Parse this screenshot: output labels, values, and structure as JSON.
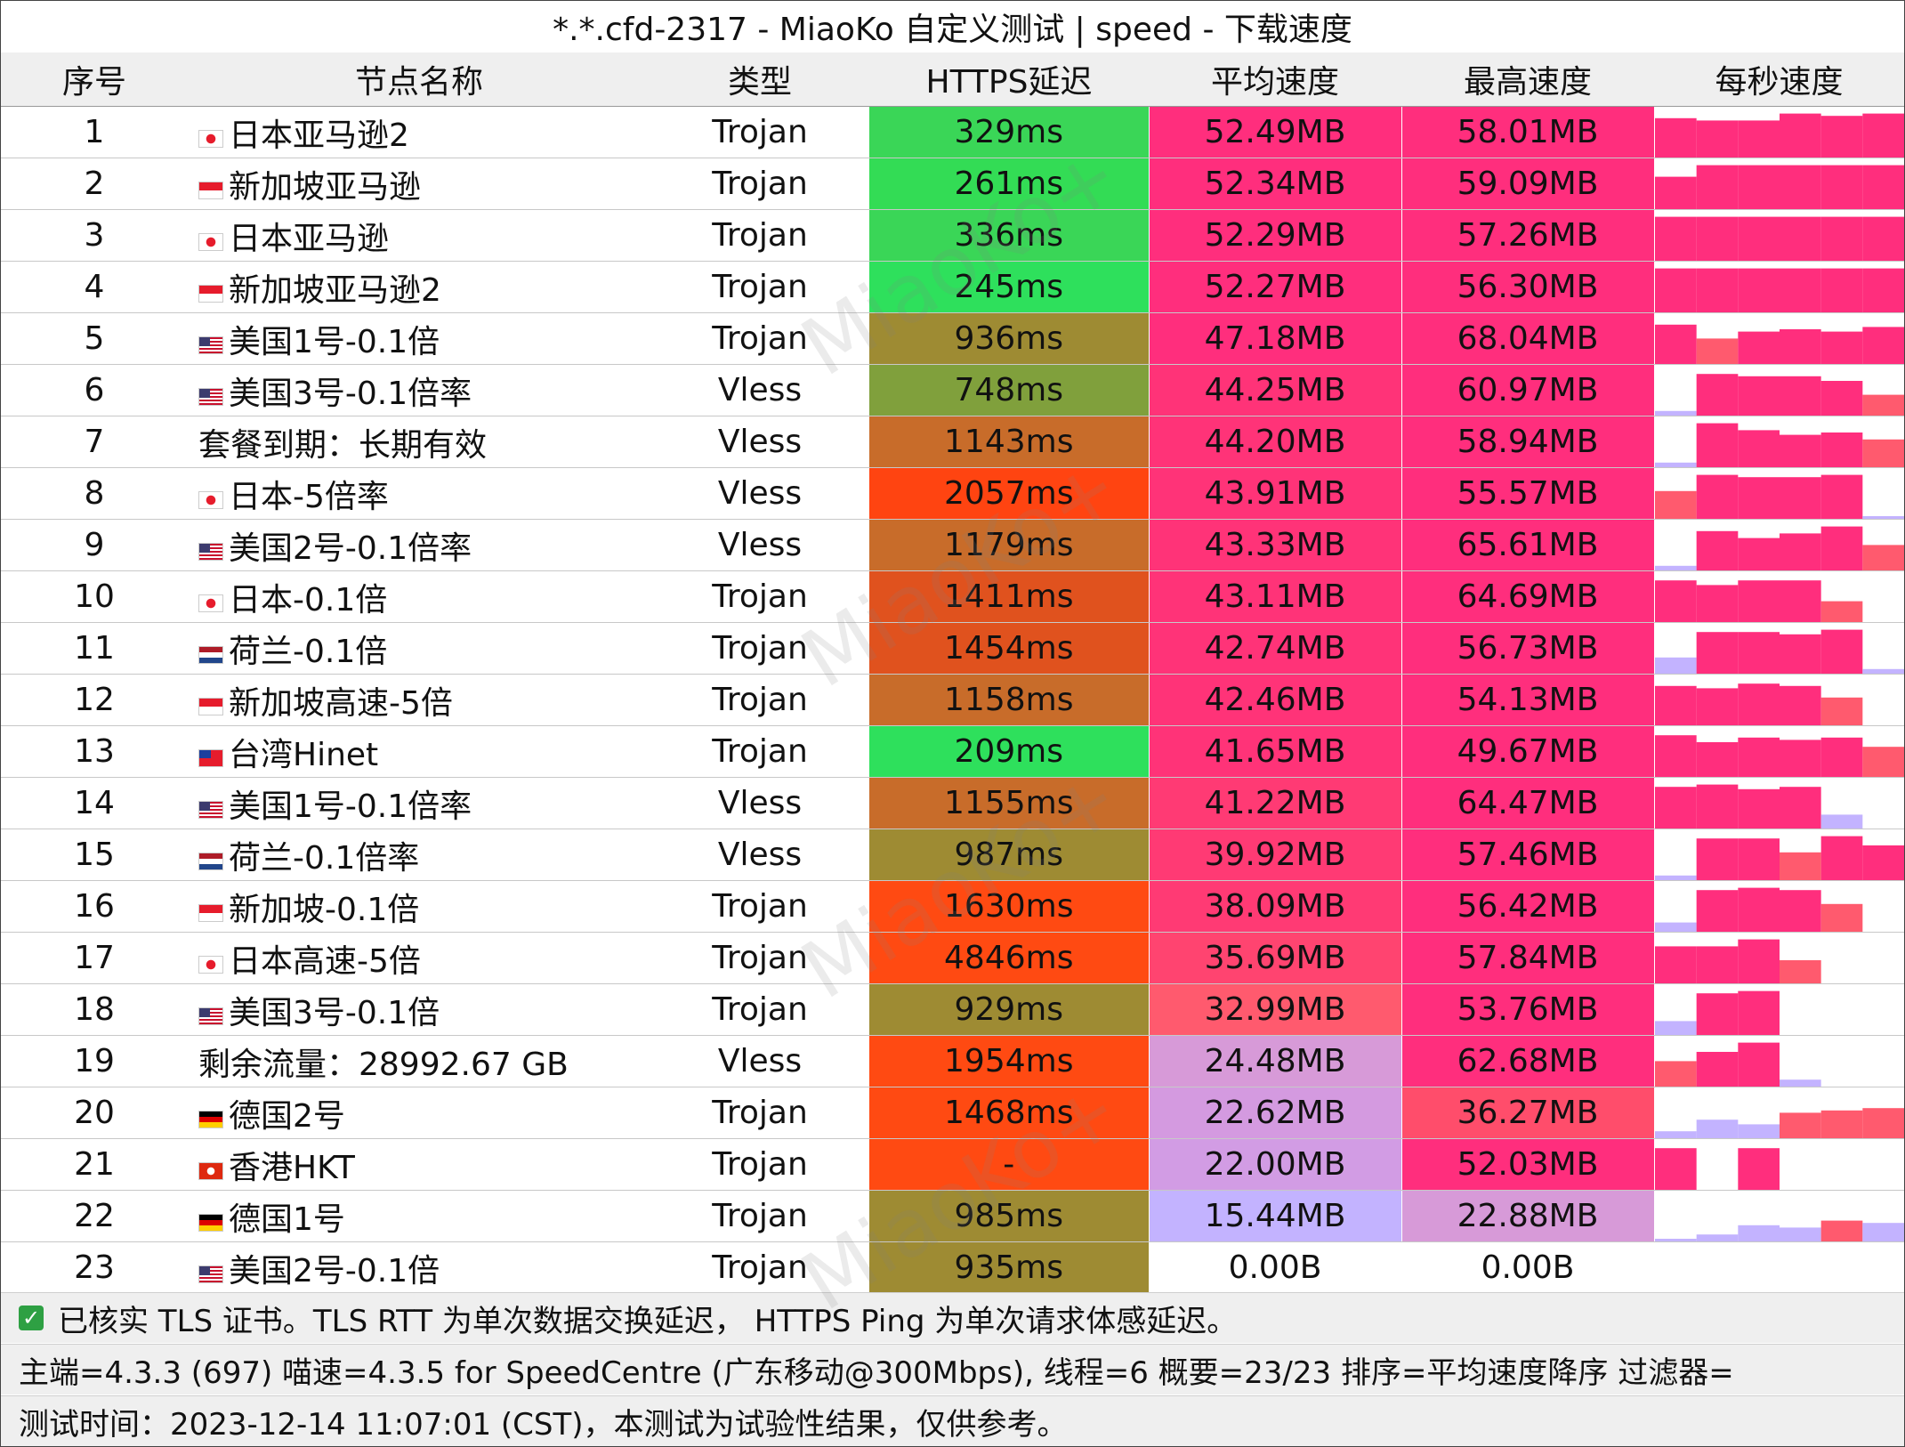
{
  "title": "*.*.cfd-2317 - MiaoKo 自定义测试 | speed - 下载速度",
  "watermark": "MiaoKo+",
  "columns": [
    "序号",
    "节点名称",
    "类型",
    "HTTPS延迟",
    "平均速度",
    "最高速度",
    "每秒速度"
  ],
  "rows": [
    {
      "idx": "1",
      "flag": "jp",
      "name": "日本亚马逊2",
      "type": "Trojan",
      "latency": "329ms",
      "latency_color": "#3ad657",
      "avg": "52.49MB",
      "avg_color": "#ff2e7d",
      "max": "58.01MB",
      "max_color": "#ff2e7d",
      "spark": [
        0.85,
        0.8,
        0.8,
        0.95,
        0.9,
        0.95
      ]
    },
    {
      "idx": "2",
      "flag": "sg",
      "name": "新加坡亚马逊",
      "type": "Trojan",
      "latency": "261ms",
      "latency_color": "#33dc55",
      "avg": "52.34MB",
      "avg_color": "#ff2e7d",
      "max": "59.09MB",
      "max_color": "#ff2e7d",
      "spark": [
        0.7,
        0.95,
        0.95,
        0.95,
        0.95,
        0.95
      ]
    },
    {
      "idx": "3",
      "flag": "jp",
      "name": "日本亚马逊",
      "type": "Trojan",
      "latency": "336ms",
      "latency_color": "#3ad657",
      "avg": "52.29MB",
      "avg_color": "#ff2e7d",
      "max": "57.26MB",
      "max_color": "#ff2e7d",
      "spark": [
        0.95,
        0.95,
        0.95,
        0.95,
        0.95,
        0.95
      ]
    },
    {
      "idx": "4",
      "flag": "sg",
      "name": "新加坡亚马逊2",
      "type": "Trojan",
      "latency": "245ms",
      "latency_color": "#2ee05c",
      "avg": "52.27MB",
      "avg_color": "#ff2e7d",
      "max": "56.30MB",
      "max_color": "#ff2e7d",
      "spark": [
        0.95,
        0.95,
        0.95,
        0.95,
        0.95,
        0.95
      ]
    },
    {
      "idx": "5",
      "flag": "us",
      "name": "美国1号-0.1倍",
      "type": "Trojan",
      "latency": "936ms",
      "latency_color": "#9e8b33",
      "avg": "47.18MB",
      "avg_color": "#ff2e7d",
      "max": "68.04MB",
      "max_color": "#ff2e7d",
      "spark": [
        0.85,
        0.55,
        0.7,
        0.75,
        0.7,
        0.8
      ]
    },
    {
      "idx": "6",
      "flag": "us",
      "name": "美国3号-0.1倍率",
      "type": "Vless",
      "latency": "748ms",
      "latency_color": "#80a03c",
      "avg": "44.25MB",
      "avg_color": "#ff3378",
      "max": "60.97MB",
      "max_color": "#ff2e7d",
      "spark": [
        0.1,
        0.9,
        0.85,
        0.85,
        0.75,
        0.45
      ]
    },
    {
      "idx": "7",
      "flag": "",
      "name": "套餐到期：长期有效",
      "type": "Vless",
      "latency": "1143ms",
      "latency_color": "#c86c2a",
      "avg": "44.20MB",
      "avg_color": "#ff3378",
      "max": "58.94MB",
      "max_color": "#ff2e7d",
      "spark": [
        0.1,
        0.95,
        0.8,
        0.7,
        0.75,
        0.6
      ]
    },
    {
      "idx": "8",
      "flag": "jp",
      "name": "日本-5倍率",
      "type": "Vless",
      "latency": "2057ms",
      "latency_color": "#ff4411",
      "avg": "43.91MB",
      "avg_color": "#ff3378",
      "max": "55.57MB",
      "max_color": "#ff2e7d",
      "spark": [
        0.6,
        0.95,
        0.9,
        0.9,
        0.95,
        0.05
      ]
    },
    {
      "idx": "9",
      "flag": "us",
      "name": "美国2号-0.1倍率",
      "type": "Vless",
      "latency": "1179ms",
      "latency_color": "#c86c2a",
      "avg": "43.33MB",
      "avg_color": "#ff3378",
      "max": "65.61MB",
      "max_color": "#ff2e7d",
      "spark": [
        0.1,
        0.85,
        0.7,
        0.8,
        0.95,
        0.55
      ]
    },
    {
      "idx": "10",
      "flag": "jp",
      "name": "日本-0.1倍",
      "type": "Trojan",
      "latency": "1411ms",
      "latency_color": "#e0521e",
      "avg": "43.11MB",
      "avg_color": "#ff3378",
      "max": "64.69MB",
      "max_color": "#ff2e7d",
      "spark": [
        0.9,
        0.8,
        0.9,
        0.9,
        0.45,
        0.0
      ]
    },
    {
      "idx": "11",
      "flag": "nl",
      "name": "荷兰-0.1倍",
      "type": "Trojan",
      "latency": "1454ms",
      "latency_color": "#e0521e",
      "avg": "42.74MB",
      "avg_color": "#ff3378",
      "max": "56.73MB",
      "max_color": "#ff2e7d",
      "spark": [
        0.35,
        0.9,
        0.9,
        0.85,
        0.95,
        0.1
      ]
    },
    {
      "idx": "12",
      "flag": "sg",
      "name": "新加坡高速-5倍",
      "type": "Trojan",
      "latency": "1158ms",
      "latency_color": "#c86c2a",
      "avg": "42.46MB",
      "avg_color": "#ff3378",
      "max": "54.13MB",
      "max_color": "#ff2e7d",
      "spark": [
        0.85,
        0.8,
        0.9,
        0.85,
        0.6,
        0.0
      ]
    },
    {
      "idx": "13",
      "flag": "tw",
      "name": "台湾Hinet",
      "type": "Trojan",
      "latency": "209ms",
      "latency_color": "#2ee05c",
      "avg": "41.65MB",
      "avg_color": "#ff3378",
      "max": "49.67MB",
      "max_color": "#ff2e7d",
      "spark": [
        0.9,
        0.75,
        0.85,
        0.8,
        0.85,
        0.65
      ]
    },
    {
      "idx": "14",
      "flag": "us",
      "name": "美国1号-0.1倍率",
      "type": "Vless",
      "latency": "1155ms",
      "latency_color": "#c86c2a",
      "avg": "41.22MB",
      "avg_color": "#ff3a74",
      "max": "64.47MB",
      "max_color": "#ff2e7d",
      "spark": [
        0.9,
        0.95,
        0.85,
        0.9,
        0.3,
        0.0
      ]
    },
    {
      "idx": "15",
      "flag": "nl",
      "name": "荷兰-0.1倍率",
      "type": "Vless",
      "latency": "987ms",
      "latency_color": "#9e8b33",
      "avg": "39.92MB",
      "avg_color": "#ff3a74",
      "max": "57.46MB",
      "max_color": "#ff2e7d",
      "spark": [
        0.1,
        0.9,
        0.9,
        0.6,
        0.95,
        0.75
      ]
    },
    {
      "idx": "16",
      "flag": "sg",
      "name": "新加坡-0.1倍",
      "type": "Trojan",
      "latency": "1630ms",
      "latency_color": "#ff4a12",
      "avg": "38.09MB",
      "avg_color": "#ff3a74",
      "max": "56.42MB",
      "max_color": "#ff2e7d",
      "spark": [
        0.2,
        0.9,
        0.95,
        0.9,
        0.6,
        0.0
      ]
    },
    {
      "idx": "17",
      "flag": "jp",
      "name": "日本高速-5倍",
      "type": "Trojan",
      "latency": "4846ms",
      "latency_color": "#ff4a12",
      "avg": "35.69MB",
      "avg_color": "#ff4470",
      "max": "57.84MB",
      "max_color": "#ff2e7d",
      "spark": [
        0.8,
        0.8,
        0.95,
        0.5,
        0.0,
        0.0
      ]
    },
    {
      "idx": "18",
      "flag": "us",
      "name": "美国3号-0.1倍",
      "type": "Trojan",
      "latency": "929ms",
      "latency_color": "#9e8b33",
      "avg": "32.99MB",
      "avg_color": "#ff5a6e",
      "max": "53.76MB",
      "max_color": "#ff2e7d",
      "spark": [
        0.3,
        0.9,
        0.95,
        0.0,
        0.0,
        0.0
      ]
    },
    {
      "idx": "19",
      "flag": "",
      "name": "剩余流量：28992.67 GB",
      "type": "Vless",
      "latency": "1954ms",
      "latency_color": "#ff4a12",
      "avg": "24.48MB",
      "avg_color": "#d79ad8",
      "max": "62.68MB",
      "max_color": "#ff2e7d",
      "spark": [
        0.55,
        0.75,
        0.95,
        0.15,
        0.0,
        0.0
      ]
    },
    {
      "idx": "20",
      "flag": "de",
      "name": "德国2号",
      "type": "Trojan",
      "latency": "1468ms",
      "latency_color": "#ff4a12",
      "avg": "22.62MB",
      "avg_color": "#d49ae0",
      "max": "36.27MB",
      "max_color": "#ff4d6b",
      "spark": [
        0.15,
        0.4,
        0.3,
        0.55,
        0.6,
        0.65
      ]
    },
    {
      "idx": "21",
      "flag": "hk",
      "name": "香港HKT",
      "type": "Trojan",
      "latency": "-",
      "latency_color": "#ff4a12",
      "avg": "22.00MB",
      "avg_color": "#d29ce4",
      "max": "52.03MB",
      "max_color": "#ff2e7d",
      "spark": [
        0.9,
        0.0,
        0.9,
        0.0,
        0.0,
        0.0
      ]
    },
    {
      "idx": "22",
      "flag": "de",
      "name": "德国1号",
      "type": "Trojan",
      "latency": "985ms",
      "latency_color": "#9e8b33",
      "avg": "15.44MB",
      "avg_color": "#c3b3ff",
      "max": "22.88MB",
      "max_color": "#d79ad8",
      "spark": [
        0.05,
        0.15,
        0.35,
        0.3,
        0.45,
        0.4
      ]
    },
    {
      "idx": "23",
      "flag": "us",
      "name": "美国2号-0.1倍",
      "type": "Trojan",
      "latency": "935ms",
      "latency_color": "#9e8b33",
      "avg": "0.00B",
      "avg_color": "#ffffff",
      "max": "0.00B",
      "max_color": "#ffffff",
      "spark": [
        0,
        0,
        0,
        0,
        0,
        0
      ]
    }
  ],
  "footer": {
    "line1": "已核实 TLS 证书。TLS RTT 为单次数据交换延迟， HTTPS Ping 为单次请求体感延迟。",
    "line2": "主端=4.3.3 (697) 喵速=4.3.5 for SpeedCentre (广东移动@300Mbps), 线程=6 概要=23/23 排序=平均速度降序 过滤器=",
    "line3": "测试时间：2023-12-14 11:07:01 (CST)，本测试为试验性结果，仅供参考。"
  },
  "colors": {
    "header_bg": "#efefef",
    "footer_bg": "#efefef",
    "check": "#2ea043",
    "spark_high": "#ff2e7d",
    "spark_mid": "#ff5a6e",
    "spark_low": "#c3b3ff"
  }
}
